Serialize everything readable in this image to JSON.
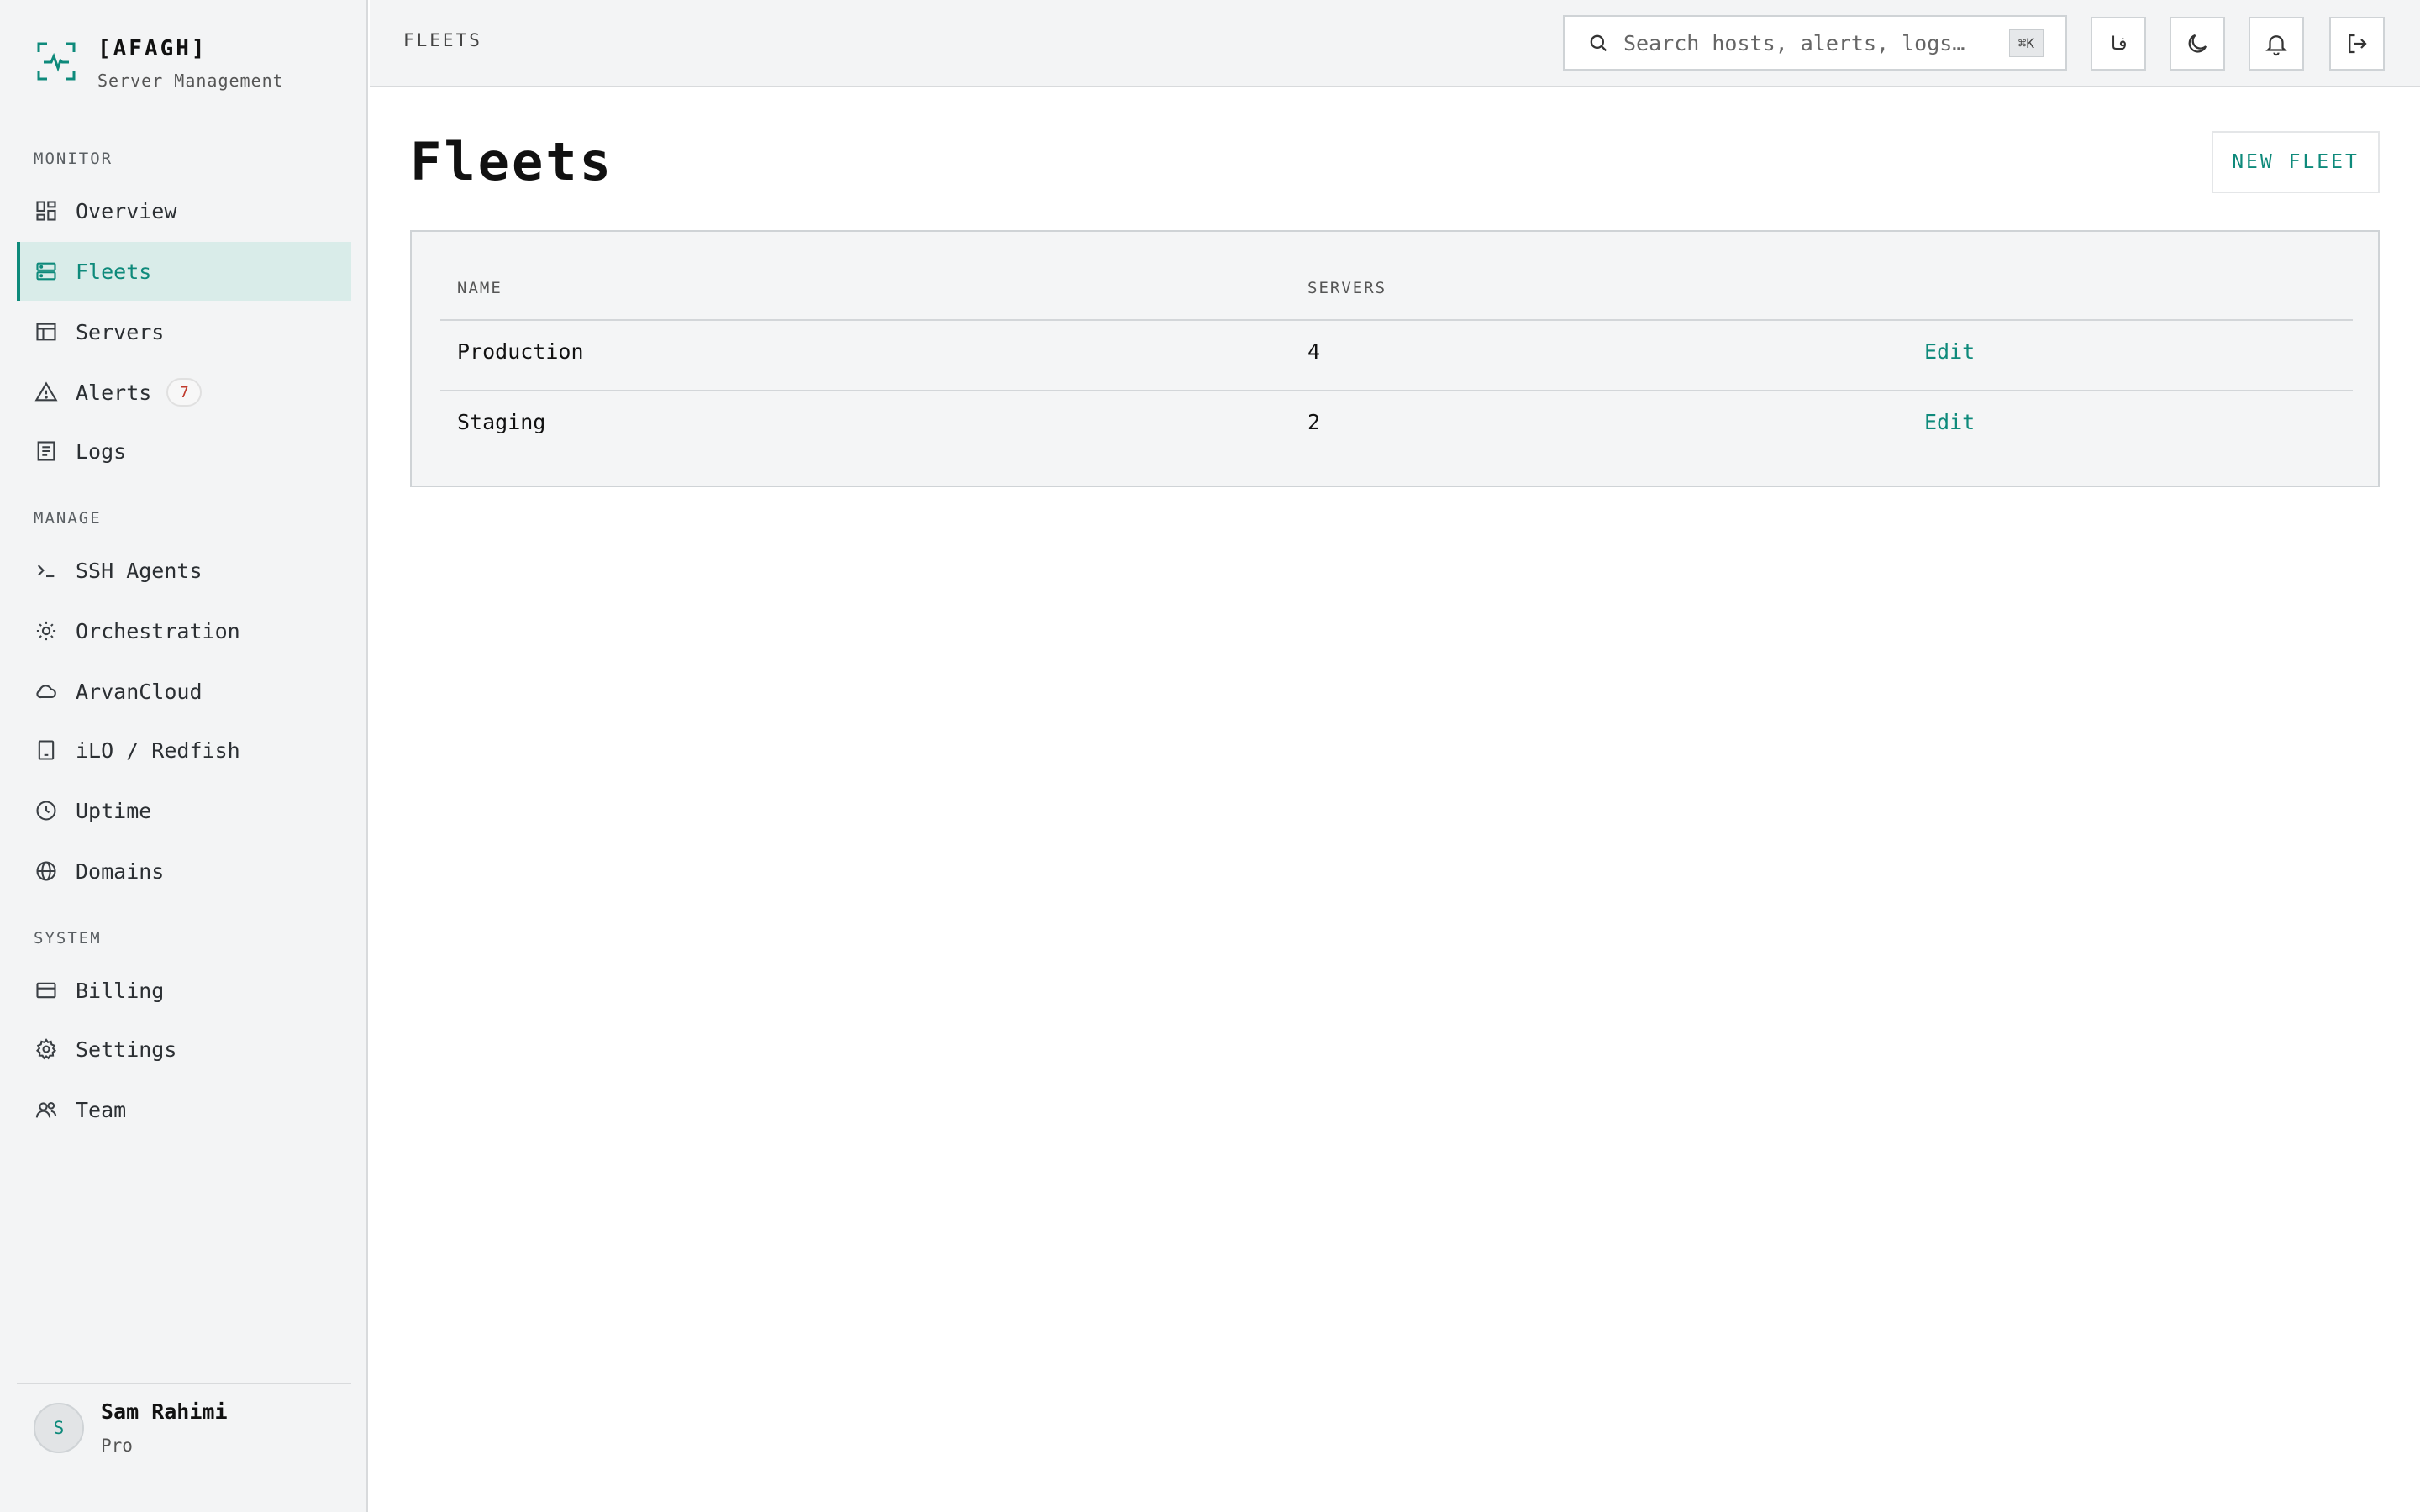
{
  "brand": {
    "name": "[AFAGH]",
    "subtitle": "Server Management"
  },
  "sidebar": {
    "sections": [
      {
        "label": "MONITOR"
      },
      {
        "label": "MANAGE"
      },
      {
        "label": "SYSTEM"
      }
    ],
    "items": [
      {
        "label": "Overview",
        "icon": "dashboard-icon"
      },
      {
        "label": "Fleets",
        "icon": "server-stack-icon",
        "active": true
      },
      {
        "label": "Servers",
        "icon": "table-icon"
      },
      {
        "label": "Alerts",
        "icon": "warning-icon",
        "badge": "7"
      },
      {
        "label": "Logs",
        "icon": "document-icon"
      },
      {
        "label": "SSH Agents",
        "icon": "terminal-icon"
      },
      {
        "label": "Orchestration",
        "icon": "sun-cog-icon"
      },
      {
        "label": "ArvanCloud",
        "icon": "cloud-icon"
      },
      {
        "label": "iLO / Redfish",
        "icon": "device-icon"
      },
      {
        "label": "Uptime",
        "icon": "clock-icon"
      },
      {
        "label": "Domains",
        "icon": "globe-icon"
      },
      {
        "label": "Billing",
        "icon": "credit-card-icon"
      },
      {
        "label": "Settings",
        "icon": "gear-icon"
      },
      {
        "label": "Team",
        "icon": "users-icon"
      }
    ]
  },
  "user": {
    "initial": "S",
    "name": "Sam Rahimi",
    "plan": "Pro"
  },
  "topbar": {
    "breadcrumb": "FLEETS",
    "search_placeholder": "Search hosts, alerts, logs…",
    "search_shortcut": "⌘K",
    "language_label": "فا"
  },
  "main": {
    "title": "Fleets",
    "new_button": "NEW FLEET",
    "table": {
      "columns": [
        "NAME",
        "SERVERS"
      ],
      "rows": [
        {
          "name": "Production",
          "servers": "4",
          "action": "Edit"
        },
        {
          "name": "Staging",
          "servers": "2",
          "action": "Edit"
        }
      ]
    }
  },
  "colors": {
    "accent": "#0e8a7b",
    "sidebar_bg": "#f3f4f5",
    "active_bg": "#d9ece9",
    "badge_text": "#c0392b"
  }
}
